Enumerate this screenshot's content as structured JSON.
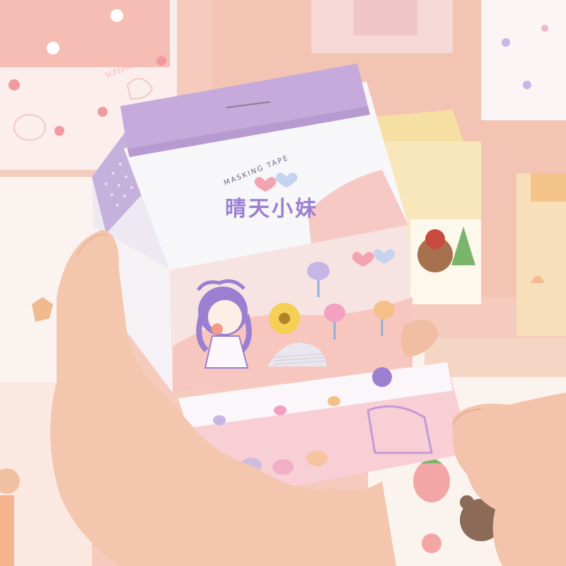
{
  "photo": {
    "box_label_top": "MASKING TAPE",
    "box_title": "晴天小妹",
    "background_box_text": "SLEEPING BUNNY",
    "colors": {
      "background": "#f4cbbd",
      "box_lid": "#c6aadb",
      "box_body": "#f7f5f8",
      "box_pink": "#f6c9c4",
      "title": "#9b7fd0",
      "skin": "#f3c6ad"
    },
    "objects": [
      "milk-carton-sticky-note-box",
      "left-hand",
      "right-hand",
      "pulled-note-strip",
      "background-carton-boxes"
    ]
  }
}
